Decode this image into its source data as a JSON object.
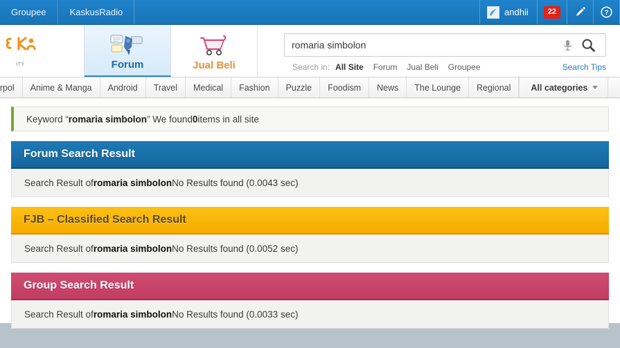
{
  "topbar": {
    "links": [
      {
        "label": "Groupee"
      },
      {
        "label": "KaskusRadio"
      }
    ],
    "username": "andhii",
    "avatar_icon": "user-avatar-icon",
    "notification_count": "22",
    "compose_icon": "pencil-icon",
    "help_icon": "question-mark-icon",
    "background_color": "#1b7bc4",
    "badge_color": "#e32219"
  },
  "header": {
    "logo": {
      "name": "kaskus-logo",
      "tagline": "ITY"
    },
    "tabs": [
      {
        "label": "Forum",
        "icon": "speech-bubbles-icon",
        "active": true
      },
      {
        "label": "Jual Beli",
        "icon": "shopping-cart-icon",
        "active": false
      }
    ]
  },
  "search": {
    "value": "romaria simbolon",
    "placeholder": "Search",
    "mic_icon": "microphone-icon",
    "submit_icon": "magnifier-icon",
    "scope_label": "Search in:",
    "scopes": [
      {
        "label": "All Site",
        "active": true
      },
      {
        "label": "Forum",
        "active": false
      },
      {
        "label": "Jual Beli",
        "active": false
      },
      {
        "label": "Groupee",
        "active": false
      }
    ],
    "tips_label": "Search Tips"
  },
  "categories": {
    "items": [
      {
        "label": "Interpol",
        "clipped": true
      },
      {
        "label": "Anime & Manga"
      },
      {
        "label": "Android"
      },
      {
        "label": "Travel"
      },
      {
        "label": "Medical"
      },
      {
        "label": "Fashion"
      },
      {
        "label": "Puzzle"
      },
      {
        "label": "Foodism"
      },
      {
        "label": "News"
      },
      {
        "label": "The Lounge"
      },
      {
        "label": "Regional"
      }
    ],
    "all_label": "All categories",
    "caret_icon": "chevron-down-icon"
  },
  "keyword_bar": {
    "prefix": "Keyword “",
    "keyword": "romaria simbolon",
    "middle": "” We found ",
    "count": "0",
    "suffix": " items in all site",
    "accent_color": "#77a82b"
  },
  "results": [
    {
      "title": "Forum Search Result",
      "style": "forum",
      "color": "#1a6fab",
      "body_prefix": "Search Result of ",
      "keyword": "romaria simbolon",
      "body_suffix": " No Results found (0.0043 sec)"
    },
    {
      "title": "FJB – Classified Search Result",
      "style": "fjb",
      "color": "#f9b400",
      "body_prefix": "Search Result of ",
      "keyword": "romaria simbolon",
      "body_suffix": "  No Results found (0.0052 sec)"
    },
    {
      "title": "Group Search Result",
      "style": "group",
      "color": "#c74168",
      "body_prefix": "Search Result of ",
      "keyword": "romaria simbolon",
      "body_suffix": " No Results found (0.0033 sec)"
    }
  ]
}
